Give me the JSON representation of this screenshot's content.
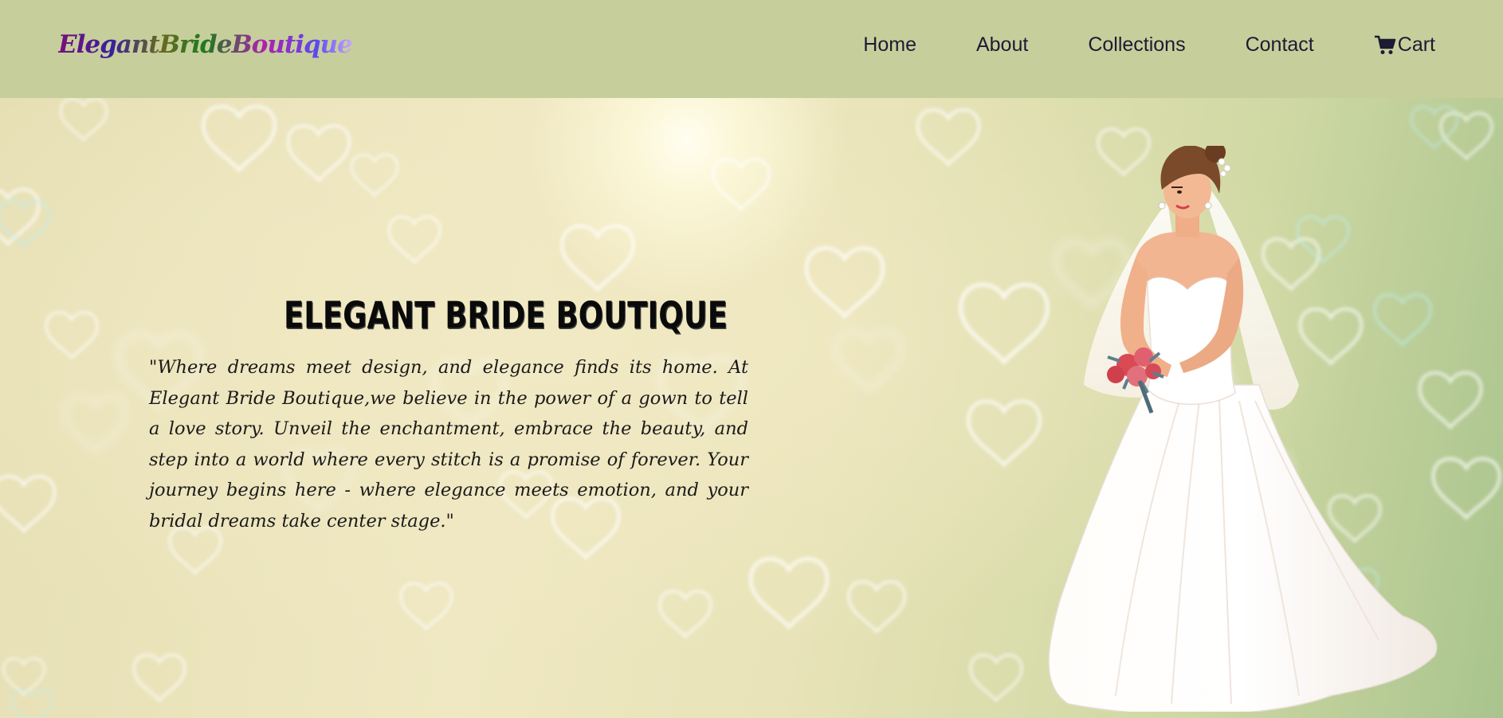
{
  "brand": {
    "logo_text": "ElegantBrideBoutique"
  },
  "nav": {
    "items": [
      {
        "label": "Home"
      },
      {
        "label": "About"
      },
      {
        "label": "Collections"
      },
      {
        "label": "Contact"
      },
      {
        "label": "Cart",
        "icon": "cart-icon"
      }
    ]
  },
  "hero": {
    "title": "ELEGANT BRIDE BOUTIQUE",
    "text": "\"Where dreams meet design, and elegance finds its home. At Elegant Bride Boutique,we believe in the power of a gown to tell a love story. Unveil the enchantment, embrace the beauty, and step into a world where every stitch is a promise of forever. Your journey begins here - where elegance meets emotion, and your bridal dreams take center stage.\""
  },
  "colors": {
    "navbar_bg": "#c6cf9c",
    "nav_text": "#1d1b33",
    "title_text": "#0a0a0a",
    "body_text": "#1a1a1a"
  }
}
